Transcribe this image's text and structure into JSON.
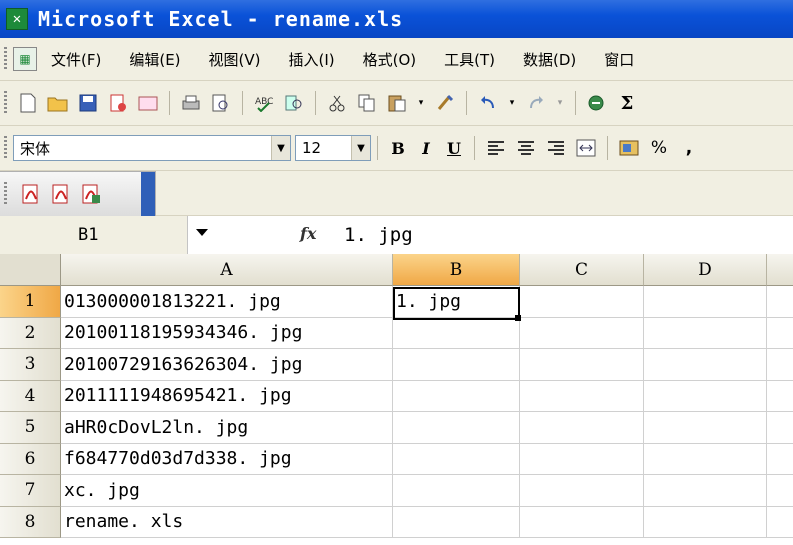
{
  "window": {
    "title": "Microsoft Excel - rename.xls"
  },
  "menu": {
    "items": [
      "文件(F)",
      "编辑(E)",
      "视图(V)",
      "插入(I)",
      "格式(O)",
      "工具(T)",
      "数据(D)",
      "窗口"
    ]
  },
  "format_toolbar": {
    "font_name": "宋体",
    "font_size": "12",
    "bold": "B",
    "italic": "I",
    "underline": "U",
    "percent": "%",
    "comma": ","
  },
  "formula_bar": {
    "name_box": "B1",
    "fx": "fx",
    "formula": "1. jpg"
  },
  "columns": [
    "A",
    "B",
    "C",
    "D"
  ],
  "rows": [
    {
      "num": "1",
      "A": "013000001813221. jpg",
      "B": "1. jpg"
    },
    {
      "num": "2",
      "A": "20100118195934346. jpg",
      "B": ""
    },
    {
      "num": "3",
      "A": "20100729163626304. jpg",
      "B": ""
    },
    {
      "num": "4",
      "A": "2011111948695421. jpg",
      "B": ""
    },
    {
      "num": "5",
      "A": "aHR0cDovL2ln. jpg",
      "B": ""
    },
    {
      "num": "6",
      "A": "f684770d03d7d338. jpg",
      "B": ""
    },
    {
      "num": "7",
      "A": "xc. jpg",
      "B": ""
    },
    {
      "num": "8",
      "A": "rename. xls",
      "B": ""
    }
  ],
  "icons": {
    "app": "excel-icon",
    "new": "new-doc-icon",
    "open": "open-folder-icon",
    "save": "save-icon",
    "print": "print-icon",
    "cut": "cut-icon",
    "copy": "copy-icon",
    "paste": "paste-icon",
    "undo": "undo-icon",
    "redo": "redo-icon",
    "sum": "sum-icon"
  },
  "colors": {
    "title_bar": "#0a52d8",
    "selection_header": "#f0a846",
    "toolbar_bg": "#f1efe2"
  }
}
